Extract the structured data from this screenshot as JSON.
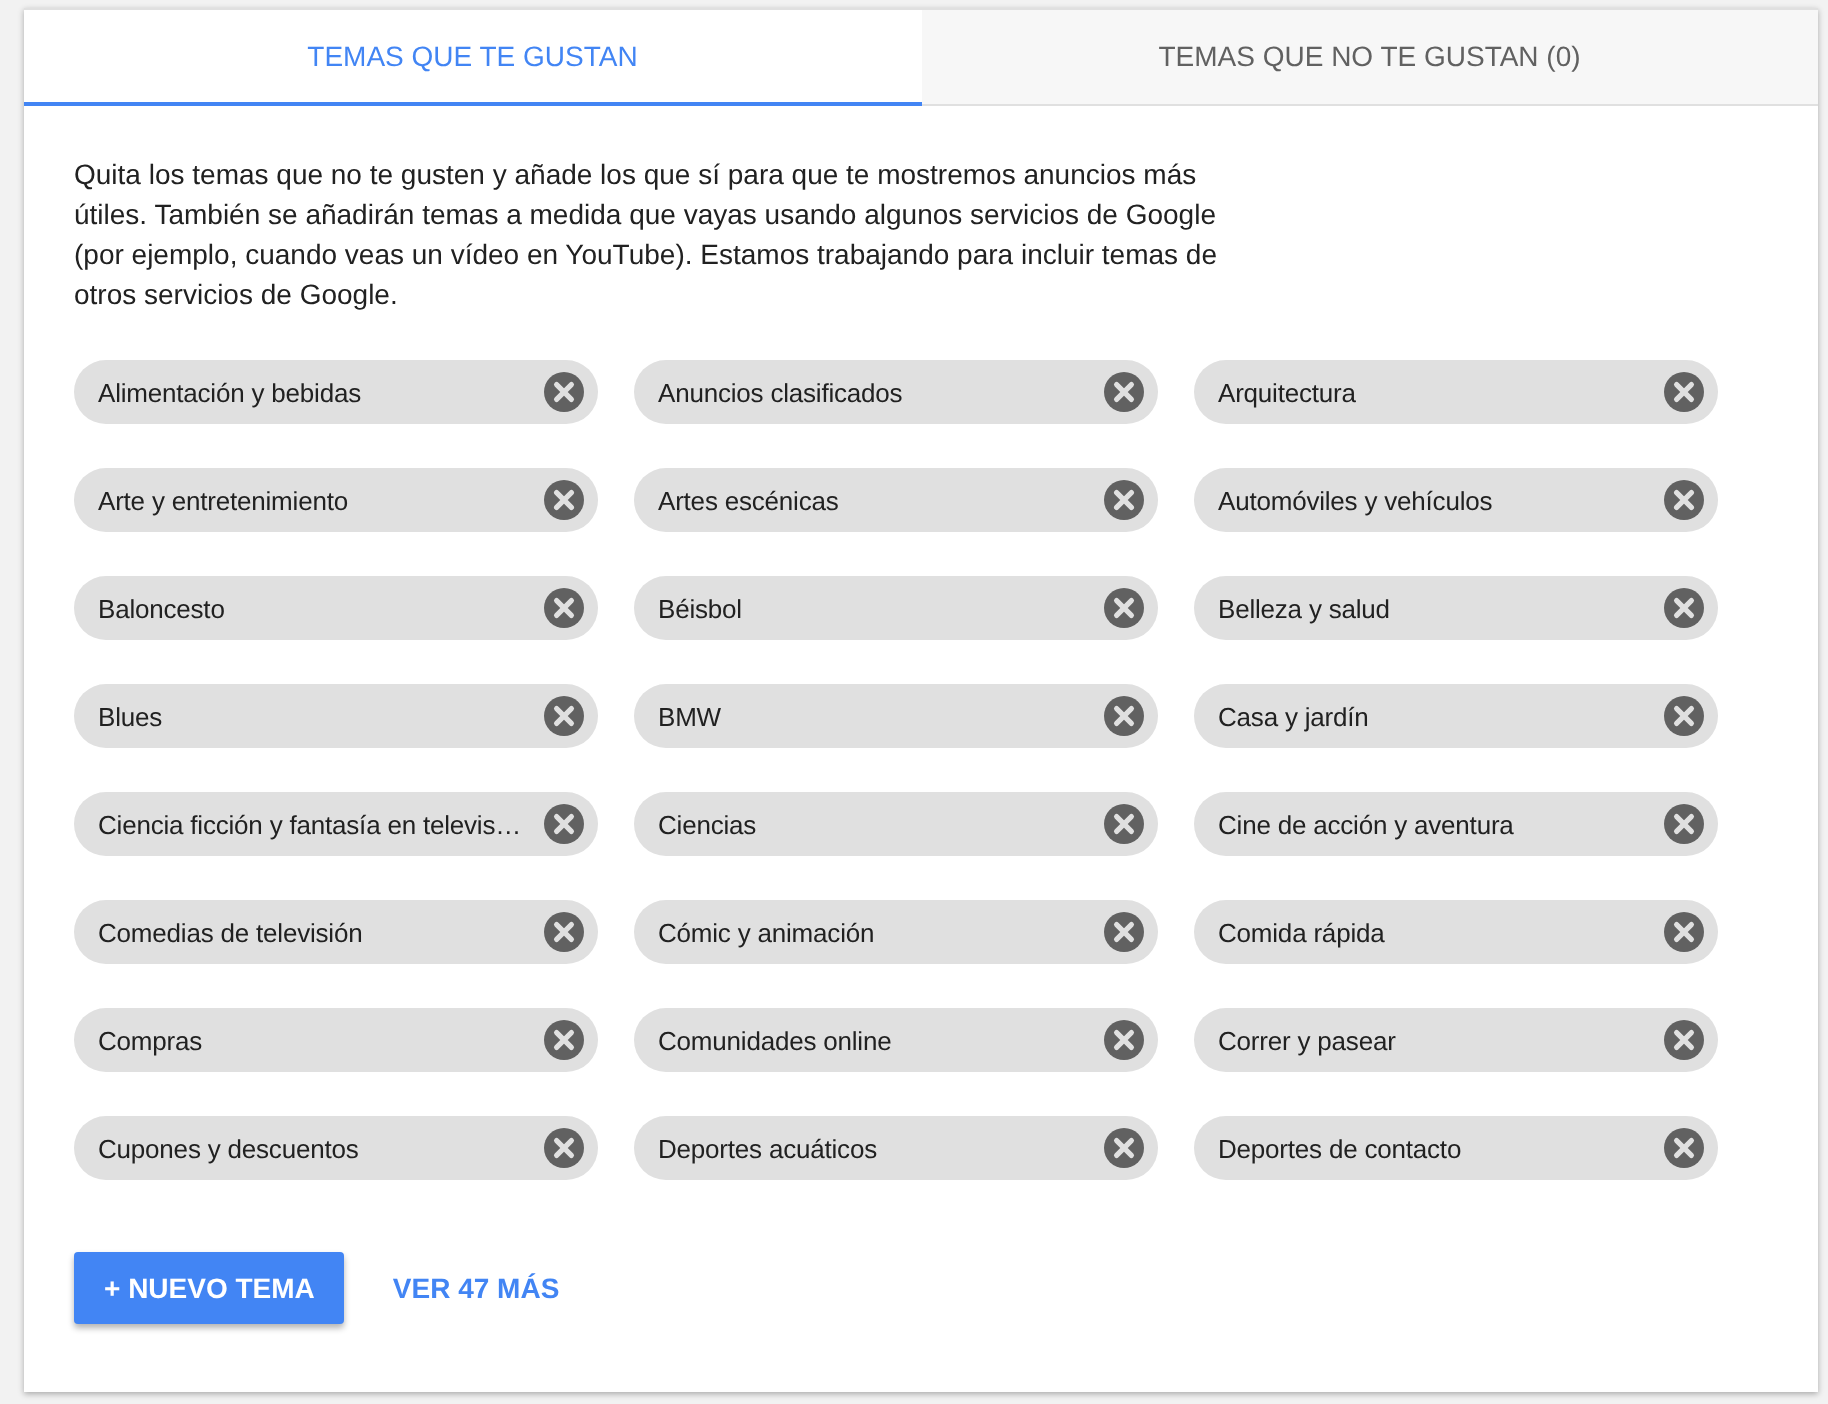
{
  "tabs": [
    {
      "label": "TEMAS QUE TE GUSTAN",
      "selected": true
    },
    {
      "label": "TEMAS QUE NO TE GUSTAN (0)",
      "selected": false
    }
  ],
  "description": "Quita los temas que no te gusten y añade los que sí para que te mostremos anuncios más útiles. También se añadirán temas a medida que vayas usando algunos servicios de Google (por ejemplo, cuando veas un vídeo en YouTube). Estamos trabajando para incluir temas de otros servicios de Google.",
  "topics": [
    "Alimentación y bebidas",
    "Anuncios clasificados",
    "Arquitectura",
    "Arte y entretenimiento",
    "Artes escénicas",
    "Automóviles y vehículos",
    "Baloncesto",
    "Béisbol",
    "Belleza y salud",
    "Blues",
    "BMW",
    "Casa y jardín",
    "Ciencia ficción y fantasía en televis…",
    "Ciencias",
    "Cine de acción y aventura",
    "Comedias de televisión",
    "Cómic y animación",
    "Comida rápida",
    "Compras",
    "Comunidades online",
    "Correr y pasear",
    "Cupones y descuentos",
    "Deportes acuáticos",
    "Deportes de contacto"
  ],
  "add_button": "+ NUEVO TEMA",
  "more_link": "VER 47 MÁS"
}
